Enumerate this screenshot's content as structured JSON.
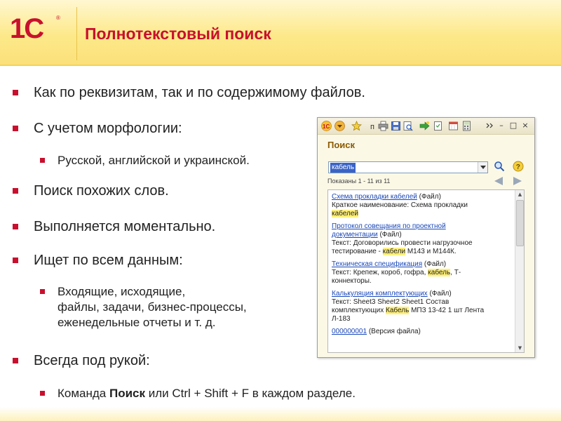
{
  "brand": {
    "logo_text": "1С",
    "accent": "#c8102e"
  },
  "slide": {
    "title": "Полнотекстовый поиск"
  },
  "bullets": [
    {
      "text": "Как по реквизитам, так и по содержимому файлов."
    },
    {
      "text": "С учетом морфологии:",
      "sub": [
        {
          "text": "Русской, английской и украинской."
        }
      ]
    },
    {
      "text": "Поиск похожих слов."
    },
    {
      "text": "Выполняется моментально."
    },
    {
      "text": "Ищет по всем данным:",
      "sub": [
        {
          "lines": [
            "Входящие, исходящие,",
            "файлы, задачи, бизнес-процессы,",
            "еженедельные отчеты и т. д."
          ]
        }
      ]
    },
    {
      "text": "Всегда под рукой:",
      "sub": [
        {
          "before": "Команда ",
          "bold": "Поиск",
          "after": " или Ctrl + Shift + F в каждом разделе."
        }
      ]
    }
  ],
  "search_window": {
    "heading": "Поиск",
    "query": "кабель",
    "shown": "Показаны 1 - 11 из 11",
    "toolbar_icons": [
      "logo-1c-icon",
      "dropdown-menu-icon",
      "favorites-star-icon",
      "n-icon",
      "print-icon",
      "save-icon",
      "preview-icon",
      "forward-icon",
      "document-icon",
      "calendar-icon",
      "calculator-icon",
      "more-icon"
    ],
    "window_controls": {
      "minimize": "–",
      "maximize": "□",
      "close": "×"
    },
    "results": [
      {
        "link": "Схема прокладки кабелей",
        "type": " (Файл)",
        "lines": [
          [
            {
              "t": "Краткое наименование: Схема прокладки"
            }
          ],
          [
            {
              "t": "кабелей",
              "hl": true
            }
          ]
        ]
      },
      {
        "link": "Протокол совещания по проектной",
        "link2": "документации",
        "type": " (Файл)",
        "lines": [
          [
            {
              "t": "Текст: Договорились провести нагрузочное"
            }
          ],
          [
            {
              "t": "тестирование - "
            },
            {
              "t": "кабели",
              "hl": true
            },
            {
              "t": " М143 и М144К."
            }
          ]
        ]
      },
      {
        "link": "Техническая спецификация",
        "type": " (Файл)",
        "lines": [
          [
            {
              "t": "Текст: Крепеж, короб, гофра, "
            },
            {
              "t": "кабель",
              "hl": true
            },
            {
              "t": ", Т-"
            }
          ],
          [
            {
              "t": "коннекторы."
            }
          ]
        ]
      },
      {
        "link": "Калькуляция комплектующих",
        "type": " (Файл)",
        "lines": [
          [
            {
              "t": "Текст: Sheet3 Sheet2 Sheet1 Состав"
            }
          ],
          [
            {
              "t": "комплектующих "
            },
            {
              "t": "Кабель",
              "hl": true
            },
            {
              "t": " МПЗ 13-42 1 шт Лента"
            }
          ],
          [
            {
              "t": "Л-183"
            }
          ]
        ]
      },
      {
        "link": "000000001",
        "type": " (Версия файла)",
        "lines": []
      }
    ]
  }
}
